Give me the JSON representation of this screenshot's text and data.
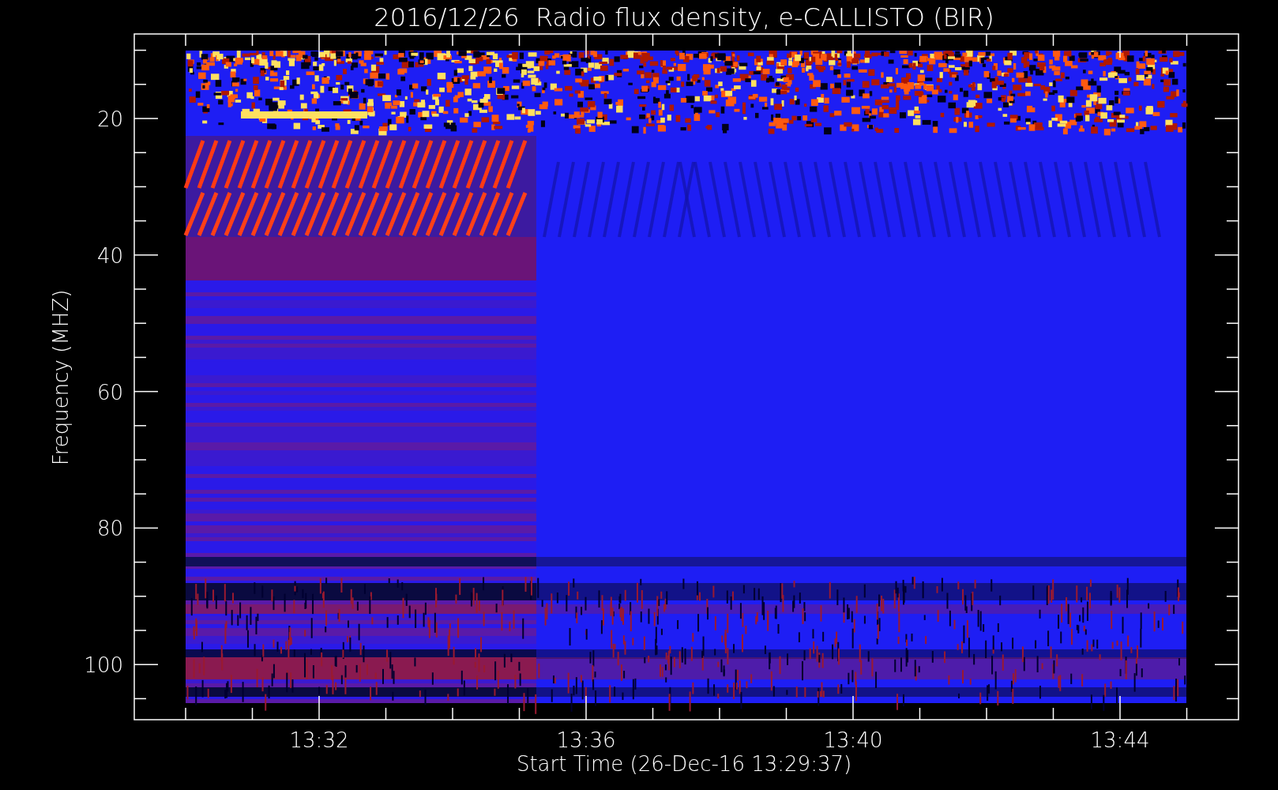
{
  "plot": {
    "title": "2016/12/26  Radio flux density, e-CALLISTO (BIR)",
    "ylabel": "Frequency (MHZ)",
    "xlabel": "Start Time (26-Dec-16 13:29:37)",
    "y_ticks": [
      "20",
      "40",
      "60",
      "80",
      "100"
    ],
    "x_ticks": [
      "13:32",
      "13:36",
      "13:40",
      "13:44"
    ]
  }
}
